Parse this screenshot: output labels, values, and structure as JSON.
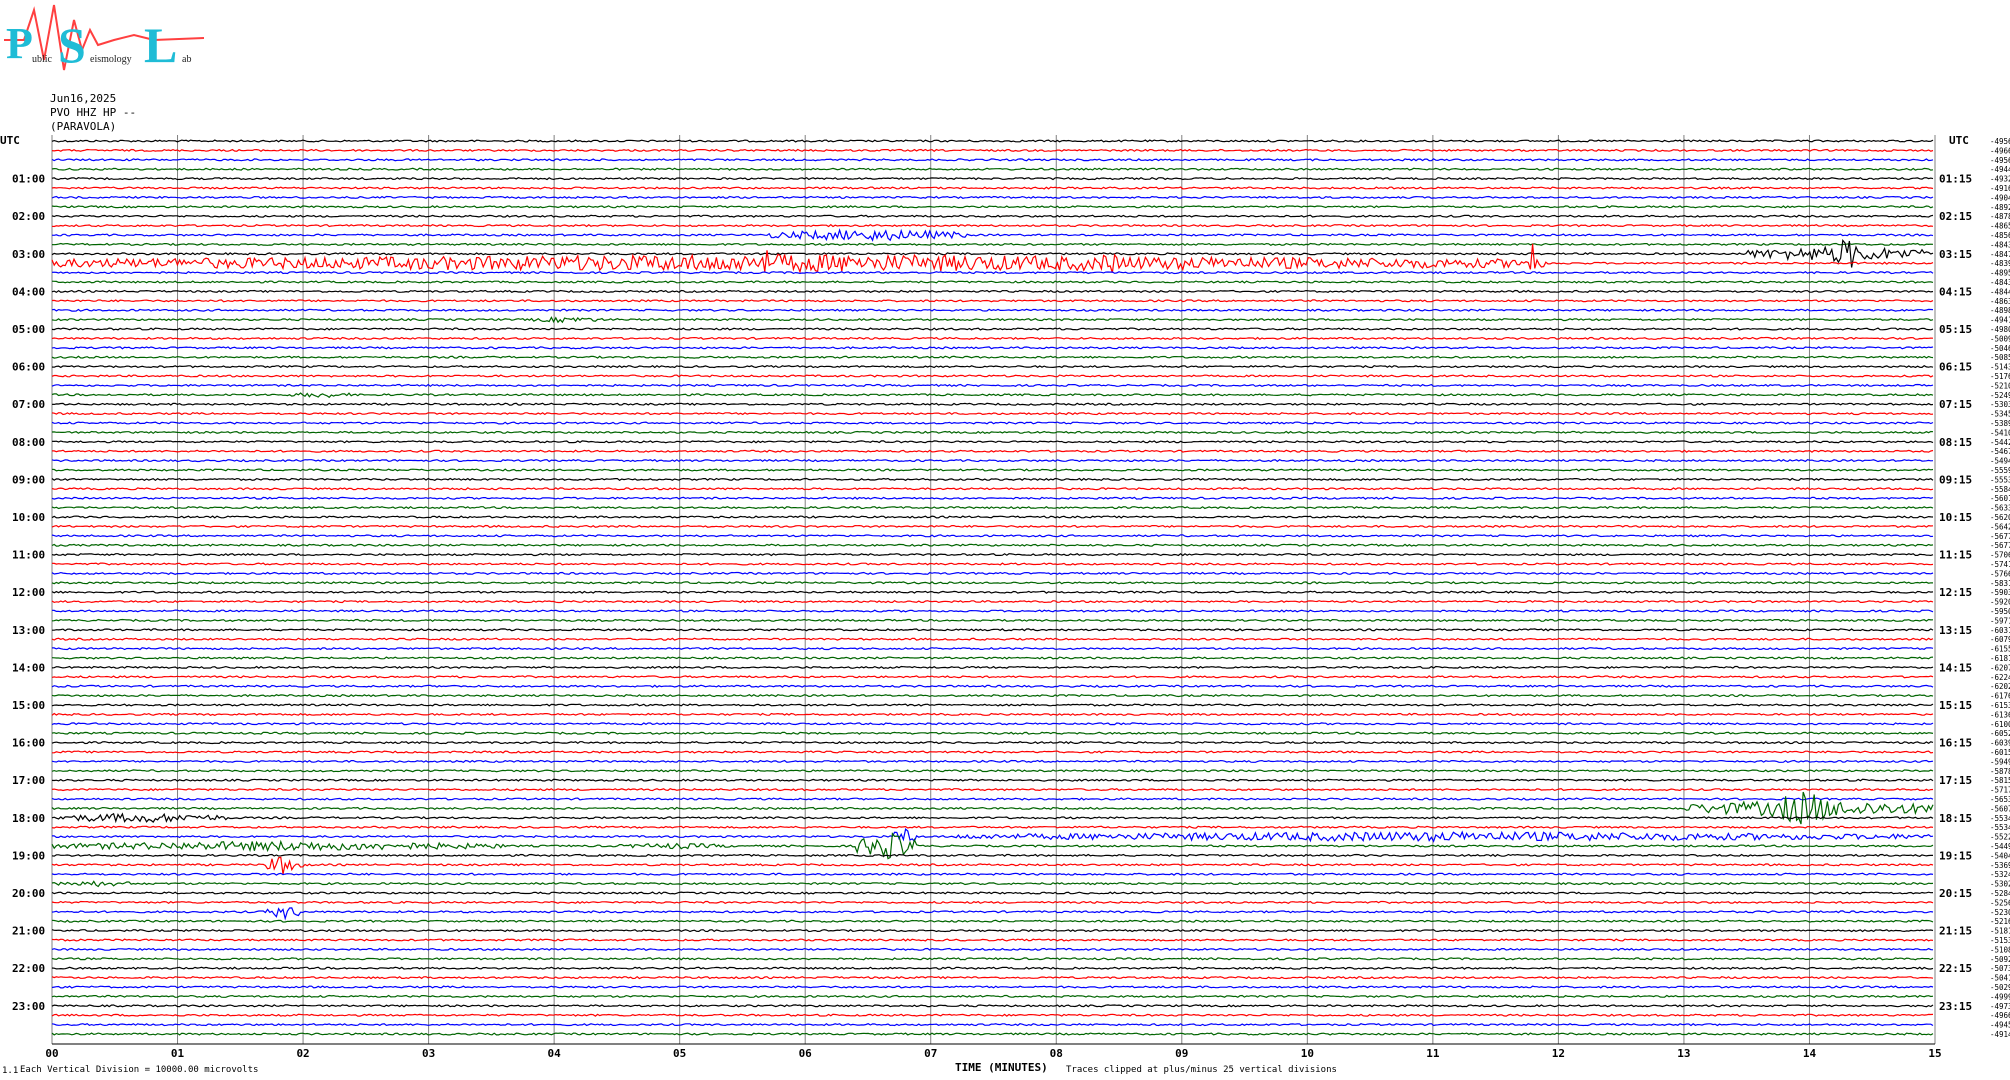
{
  "logo": {
    "text_p": "P",
    "text_s": "S",
    "text_l": "L",
    "small_1": "ublic",
    "small_2": "eismology",
    "small_3": "ab"
  },
  "header": {
    "date": "Jun16,2025",
    "station": "PVO HHZ HP --",
    "name": "(PARAVOLA)"
  },
  "utc_left": "UTC",
  "utc_right": "UTC",
  "footer": {
    "scale": "Each Vertical Division = 10000.00 microvolts",
    "xlabel": "TIME (MINUTES)",
    "clip": "Traces clipped at plus/minus 25 vertical divisions",
    "corner": "1.1"
  },
  "colors": {
    "black": "#000000",
    "red": "#ff0000",
    "blue": "#0000ff",
    "green": "#006400",
    "grid": "#808080"
  },
  "chart_data": {
    "type": "line",
    "title": "",
    "xlabel": "TIME (MINUTES)",
    "xlim": [
      0,
      15
    ],
    "x_ticks": [
      "00",
      "01",
      "02",
      "03",
      "04",
      "05",
      "06",
      "07",
      "08",
      "09",
      "10",
      "11",
      "12",
      "13",
      "14",
      "15"
    ],
    "row_count": 96,
    "row_colors": [
      "black",
      "red",
      "blue",
      "green"
    ],
    "left_hour_labels": [
      "01:00",
      "02:00",
      "03:00",
      "04:00",
      "05:00",
      "06:00",
      "07:00",
      "08:00",
      "09:00",
      "10:00",
      "11:00",
      "12:00",
      "13:00",
      "14:00",
      "15:00",
      "16:00",
      "17:00",
      "18:00",
      "19:00",
      "20:00",
      "21:00",
      "22:00",
      "23:00"
    ],
    "right_hour_labels": [
      "01:15",
      "02:15",
      "03:15",
      "04:15",
      "05:15",
      "06:15",
      "07:15",
      "08:15",
      "09:15",
      "10:15",
      "11:15",
      "12:15",
      "13:15",
      "14:15",
      "15:15",
      "16:15",
      "17:15",
      "18:15",
      "19:15",
      "20:15",
      "21:15",
      "22:15",
      "23:15"
    ],
    "row_offsets": [
      -4956,
      -4966,
      -4956,
      -4944,
      -4932,
      -4916,
      -4904,
      -4892,
      -4878,
      -4865,
      -4856,
      -4843,
      -4847,
      -4839,
      -4895,
      -4843,
      -4844,
      -4863,
      -4898,
      -4941,
      -4980,
      -5009,
      -5046,
      -5085,
      -5143,
      -5176,
      -5210,
      -5249,
      -5303,
      -5345,
      -5389,
      -5410,
      -5442,
      -5467,
      -5494,
      -5559,
      -5553,
      -5584,
      -5601,
      -5633,
      -5620,
      -5642,
      -5677,
      -5677,
      -5706,
      -5741,
      -5766,
      -5831,
      -5903,
      -5920,
      -5950,
      -5971,
      -6031,
      -6079,
      -6155,
      -6181,
      -6207,
      -6224,
      -6202,
      -6176,
      -6153,
      -6136,
      -6100,
      -6052,
      -6039,
      -6015,
      -5949,
      -5878,
      -5815,
      -5717,
      -5653,
      -5607,
      -5534,
      -5534,
      -5522,
      -5449,
      -5404,
      -5369,
      -5324,
      -5302,
      -5284,
      -5256,
      -5230,
      -5216,
      -5181,
      -5153,
      -5108,
      -5092,
      -5073,
      -5041,
      -5029,
      -4999,
      -4973,
      -4966,
      -4945,
      -4914
    ],
    "events": [
      {
        "row": 13,
        "start": 0.0,
        "end": 11.9,
        "amp": 9
      },
      {
        "row": 13,
        "start": 5.6,
        "end": 5.8,
        "amp": 14
      },
      {
        "row": 13,
        "start": 8.35,
        "end": 8.5,
        "amp": 13
      },
      {
        "row": 13,
        "start": 11.75,
        "end": 11.85,
        "amp": 30
      },
      {
        "row": 10,
        "start": 5.7,
        "end": 7.3,
        "amp": 6
      },
      {
        "row": 12,
        "start": 13.5,
        "end": 15.0,
        "amp": 8
      },
      {
        "row": 12,
        "start": 14.2,
        "end": 14.4,
        "amp": 18
      },
      {
        "row": 19,
        "start": 3.8,
        "end": 4.4,
        "amp": 3
      },
      {
        "row": 27,
        "start": 1.9,
        "end": 2.4,
        "amp": 3
      },
      {
        "row": 72,
        "start": 0.0,
        "end": 1.4,
        "amp": 5
      },
      {
        "row": 71,
        "start": 13.0,
        "end": 15.0,
        "amp": 9
      },
      {
        "row": 71,
        "start": 13.7,
        "end": 14.2,
        "amp": 18
      },
      {
        "row": 74,
        "start": 7.2,
        "end": 15.0,
        "amp": 5
      },
      {
        "row": 74,
        "start": 6.7,
        "end": 6.9,
        "amp": 9
      },
      {
        "row": 75,
        "start": 0.0,
        "end": 3.6,
        "amp": 5
      },
      {
        "row": 75,
        "start": 6.4,
        "end": 6.9,
        "amp": 14
      },
      {
        "row": 75,
        "start": 4.5,
        "end": 5.4,
        "amp": 3
      },
      {
        "row": 77,
        "start": 1.7,
        "end": 2.0,
        "amp": 10
      },
      {
        "row": 82,
        "start": 1.7,
        "end": 2.0,
        "amp": 7
      },
      {
        "row": 79,
        "start": 0.0,
        "end": 0.7,
        "amp": 3
      }
    ]
  }
}
